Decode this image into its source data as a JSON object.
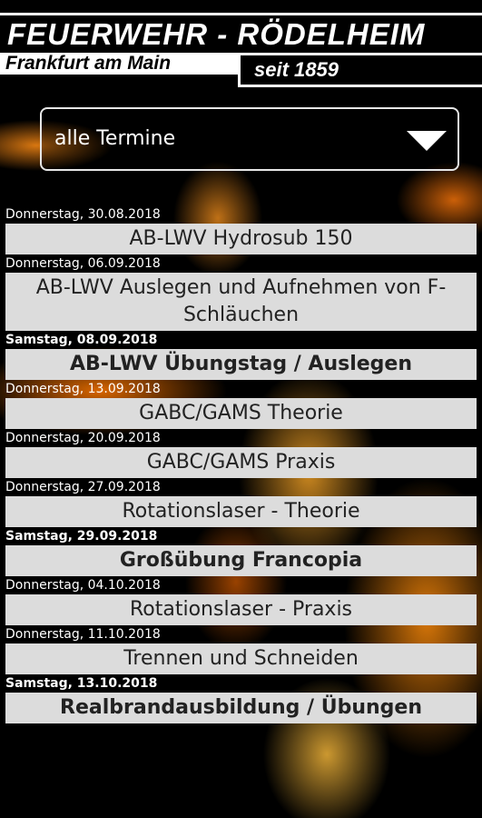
{
  "header": {
    "title": "FEUERWEHR - RÖDELHEIM",
    "subtitle": "Frankfurt am Main",
    "since": "seit 1859"
  },
  "filter": {
    "selected": "alle Termine"
  },
  "events": [
    {
      "date": "Donnerstag, 30.08.2018",
      "title": "AB-LWV Hydrosub 150",
      "bold": false
    },
    {
      "date": "Donnerstag, 06.09.2018",
      "title": "AB-LWV Auslegen und Aufnehmen von F-Schläuchen",
      "bold": false
    },
    {
      "date": "Samstag, 08.09.2018",
      "title": "AB-LWV Übungstag / Auslegen",
      "bold": true
    },
    {
      "date": "Donnerstag, 13.09.2018",
      "title": "GABC/GAMS Theorie",
      "bold": false
    },
    {
      "date": "Donnerstag, 20.09.2018",
      "title": "GABC/GAMS Praxis",
      "bold": false
    },
    {
      "date": "Donnerstag, 27.09.2018",
      "title": "Rotationslaser - Theorie",
      "bold": false
    },
    {
      "date": "Samstag, 29.09.2018",
      "title": "Großübung Francopia",
      "bold": true
    },
    {
      "date": "Donnerstag, 04.10.2018",
      "title": "Rotationslaser - Praxis",
      "bold": false
    },
    {
      "date": "Donnerstag, 11.10.2018",
      "title": "Trennen und Schneiden",
      "bold": false
    },
    {
      "date": "Samstag, 13.10.2018",
      "title": "Realbrandausbildung / Übungen",
      "bold": true
    }
  ]
}
